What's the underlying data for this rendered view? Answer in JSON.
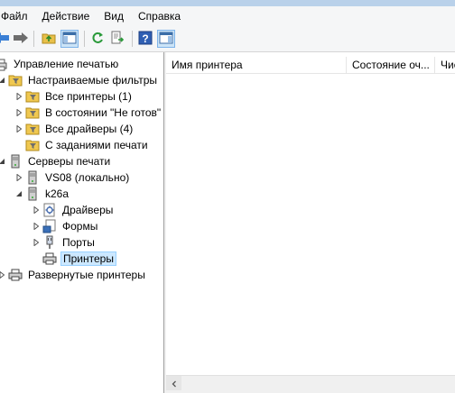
{
  "menu": {
    "items": [
      "Файл",
      "Действие",
      "Вид",
      "Справка"
    ]
  },
  "toolbar": {
    "buttons": [
      "back-icon",
      "forward-icon",
      "up-folder-icon",
      "show-hide-tree-icon",
      "refresh-icon",
      "export-list-icon",
      "help-icon",
      "show-hide-action-pane-icon"
    ]
  },
  "tree": {
    "root": "Управление печатью",
    "filters": "Настраиваемые фильтры",
    "all_printers": "Все принтеры (1)",
    "not_ready": "В состоянии \"Не готов\"",
    "all_drivers": "Все драйверы (4)",
    "with_jobs": "С заданиями печати",
    "servers": "Серверы печати",
    "server_local": "VS08 (локально)",
    "server_k26a": "k26a",
    "drivers": "Драйверы",
    "forms": "Формы",
    "ports": "Порты",
    "printers": "Принтеры",
    "deployed": "Развернутые принтеры"
  },
  "list": {
    "columns": [
      "Имя принтера",
      "Состояние оч...",
      "Чис"
    ]
  }
}
